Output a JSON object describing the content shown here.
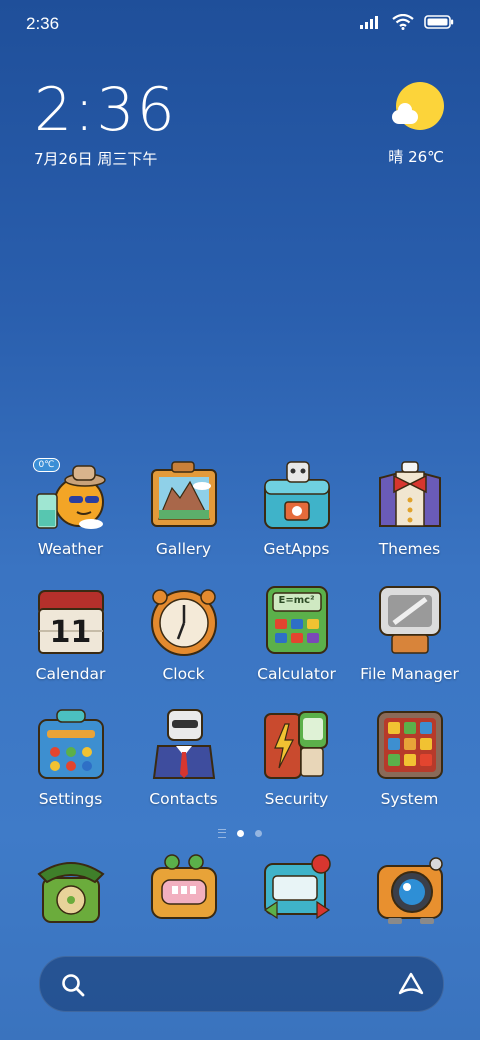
{
  "status_bar": {
    "time": "2:36",
    "icons": [
      "signal-icon",
      "wifi-icon",
      "battery-icon"
    ]
  },
  "clock_widget": {
    "time": "2:36",
    "date": "7月26日 周三下午"
  },
  "weather_widget": {
    "condition_temp": "晴 26℃",
    "icon": "sun-cloud-icon"
  },
  "apps": [
    {
      "label": "Weather",
      "icon": "weather-icon",
      "badge": "0℃"
    },
    {
      "label": "Gallery",
      "icon": "gallery-icon"
    },
    {
      "label": "GetApps",
      "icon": "getapps-icon"
    },
    {
      "label": "Themes",
      "icon": "themes-icon"
    },
    {
      "label": "Calendar",
      "icon": "calendar-icon",
      "day": "11"
    },
    {
      "label": "Clock",
      "icon": "clock-icon"
    },
    {
      "label": "Calculator",
      "icon": "calculator-icon",
      "formula": "E=mc²"
    },
    {
      "label": "File Manager",
      "icon": "file-manager-icon"
    },
    {
      "label": "Settings",
      "icon": "settings-icon"
    },
    {
      "label": "Contacts",
      "icon": "contacts-icon"
    },
    {
      "label": "Security",
      "icon": "security-icon"
    },
    {
      "label": "System",
      "icon": "system-icon"
    }
  ],
  "page_indicator": {
    "pages": 2,
    "active": 0
  },
  "dock": [
    {
      "icon": "phone-icon"
    },
    {
      "icon": "messaging-icon"
    },
    {
      "icon": "browser-icon"
    },
    {
      "icon": "camera-icon"
    }
  ],
  "search_bar": {
    "left_icon": "search-icon",
    "right_icon": "assistant-icon"
  }
}
